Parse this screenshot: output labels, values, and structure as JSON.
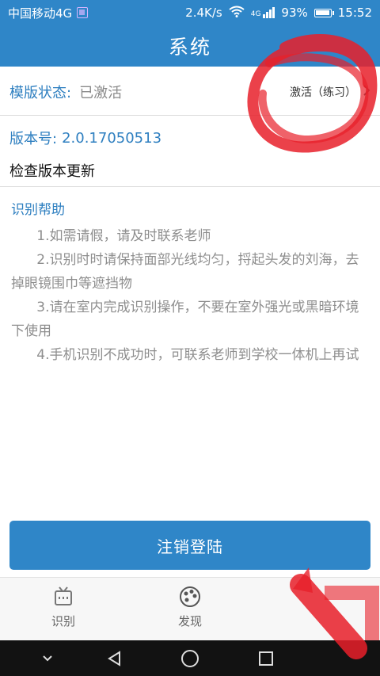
{
  "status_bar": {
    "carrier": "中国移动4G",
    "speed": "2.4K/s",
    "network": "4G",
    "battery": "93%",
    "time": "15:52"
  },
  "header": {
    "title": "系统"
  },
  "template": {
    "label": "模版状态:",
    "value": "已激活",
    "action": "激活（练习）"
  },
  "version": {
    "label": "版本号:",
    "value": "2.0.17050513"
  },
  "update": {
    "label": "检查版本更新"
  },
  "help": {
    "title": "识别帮助",
    "items": [
      "1.如需请假，请及时联系老师",
      "2.识别时时请保持面部光线均匀，捋起头发的刘海，去掉眼镜围巾等遮挡物",
      "3.请在室内完成识别操作，不要在室外强光或黑暗环境下使用",
      "4.手机识别不成功时，可联系老师到学校一体机上再试"
    ]
  },
  "logout": {
    "label": "注销登陆"
  },
  "tabs": [
    {
      "label": "识别",
      "icon": "tv-icon"
    },
    {
      "label": "发现",
      "icon": "palette-icon"
    }
  ],
  "colors": {
    "brand": "#2f86c8",
    "annotation": "#e8202a"
  }
}
